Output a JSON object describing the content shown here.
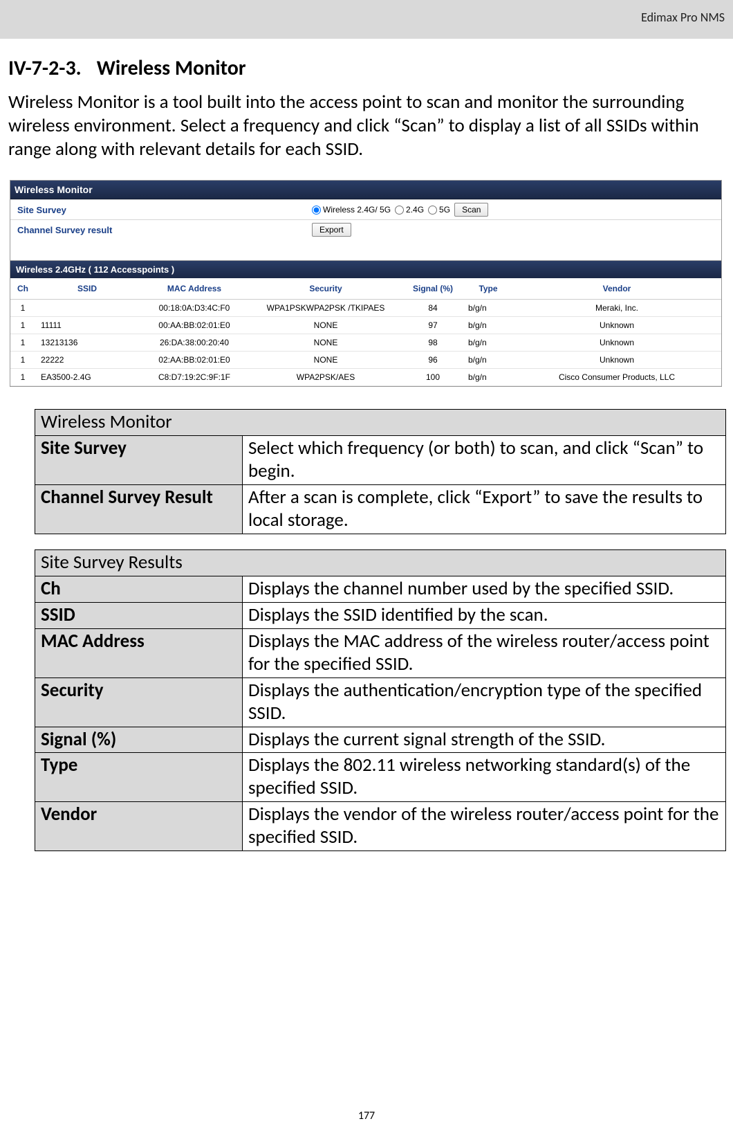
{
  "header": {
    "brand": "Edimax Pro NMS"
  },
  "section": {
    "number": "IV-7-2-3.",
    "title": "Wireless Monitor"
  },
  "intro": "Wireless Monitor is a tool built into the access point to scan and monitor the surrounding wireless environment. Select a frequency and click “Scan” to display a list of all SSIDs within range along with relevant details for each SSID.",
  "app": {
    "panel_title": "Wireless Monitor",
    "form": {
      "site_survey_label": "Site Survey",
      "channel_survey_label": "Channel Survey result",
      "opt_both": "Wireless 2.4G/ 5G",
      "opt_24g": "2.4G",
      "opt_5g": "5G",
      "scan_btn": "Scan",
      "export_btn": "Export"
    },
    "results_title": "Wireless 2.4GHz ( 112 Accesspoints )",
    "columns": {
      "ch": "Ch",
      "ssid": "SSID",
      "mac": "MAC Address",
      "sec": "Security",
      "sig": "Signal (%)",
      "type": "Type",
      "vendor": "Vendor"
    },
    "rows": [
      {
        "ch": "1",
        "ssid": "",
        "mac": "00:18:0A:D3:4C:F0",
        "sec": "WPA1PSKWPA2PSK /TKIPAES",
        "sig": "84",
        "type": "b/g/n",
        "vendor": "Meraki, Inc."
      },
      {
        "ch": "1",
        "ssid": "11111",
        "mac": "00:AA:BB:02:01:E0",
        "sec": "NONE",
        "sig": "97",
        "type": "b/g/n",
        "vendor": "Unknown"
      },
      {
        "ch": "1",
        "ssid": "13213136",
        "mac": "26:DA:38:00:20:40",
        "sec": "NONE",
        "sig": "98",
        "type": "b/g/n",
        "vendor": "Unknown"
      },
      {
        "ch": "1",
        "ssid": "22222",
        "mac": "02:AA:BB:02:01:E0",
        "sec": "NONE",
        "sig": "96",
        "type": "b/g/n",
        "vendor": "Unknown"
      },
      {
        "ch": "1",
        "ssid": "EA3500-2.4G",
        "mac": "C8:D7:19:2C:9F:1F",
        "sec": "WPA2PSK/AES",
        "sig": "100",
        "type": "b/g/n",
        "vendor": "Cisco Consumer Products, LLC"
      }
    ]
  },
  "desc1": {
    "header": "Wireless Monitor",
    "rows": [
      {
        "k": "Site Survey",
        "v": "Select which frequency (or both) to scan, and click “Scan” to begin."
      },
      {
        "k": "Channel Survey Result",
        "v": "After a scan is complete, click “Export” to save the results to local storage."
      }
    ]
  },
  "desc2": {
    "header": "Site Survey Results",
    "rows": [
      {
        "k": "Ch",
        "v": "Displays the channel number used by the specified SSID."
      },
      {
        "k": "SSID",
        "v": "Displays the SSID identified by the scan."
      },
      {
        "k": "MAC Address",
        "v": "Displays the MAC address of the wireless router/access point for the specified SSID."
      },
      {
        "k": "Security",
        "v": "Displays the authentication/encryption type of the specified SSID."
      },
      {
        "k": "Signal (%)",
        "v": "Displays the current signal strength of the SSID."
      },
      {
        "k": "Type",
        "v": "Displays the 802.11 wireless networking standard(s) of the specified SSID."
      },
      {
        "k": "Vendor",
        "v": "Displays the vendor of the wireless router/access point for the specified SSID."
      }
    ]
  },
  "page_num": "177"
}
